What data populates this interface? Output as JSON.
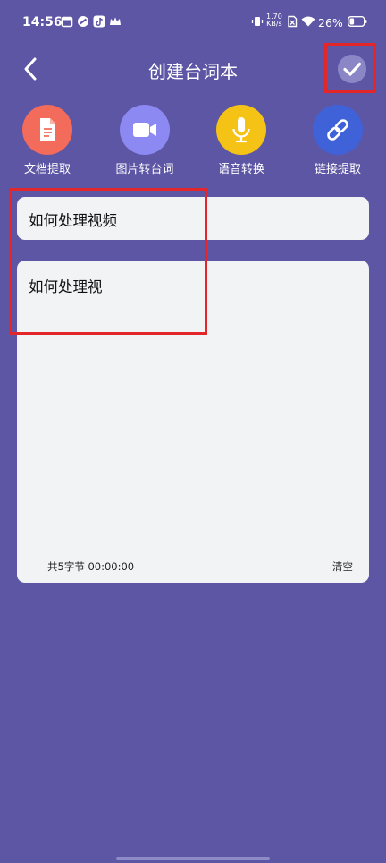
{
  "status_bar": {
    "time": "14:56",
    "net_speed_value": "1.70",
    "net_speed_unit": "KB/s",
    "battery": "26%"
  },
  "header": {
    "title": "创建台词本",
    "back_icon": "chevron-left-icon",
    "confirm_icon": "check-icon"
  },
  "tools": [
    {
      "label": "文档提取",
      "icon": "document-icon",
      "color": "#F26B5B"
    },
    {
      "label": "图片转台词",
      "icon": "video-camera-icon",
      "color": "#8C89F2"
    },
    {
      "label": "语音转换",
      "icon": "microphone-icon",
      "color": "#F5C216"
    },
    {
      "label": "链接提取",
      "icon": "link-icon",
      "color": "#3F62D8"
    }
  ],
  "editor": {
    "title_value": "如何处理视频",
    "body_value": "如何处理视",
    "stats": "共5字节 00:00:00",
    "clear_label": "清空"
  },
  "colors": {
    "background": "#5D56A4",
    "card": "#F2F3F5",
    "highlight": "#E3262A"
  }
}
